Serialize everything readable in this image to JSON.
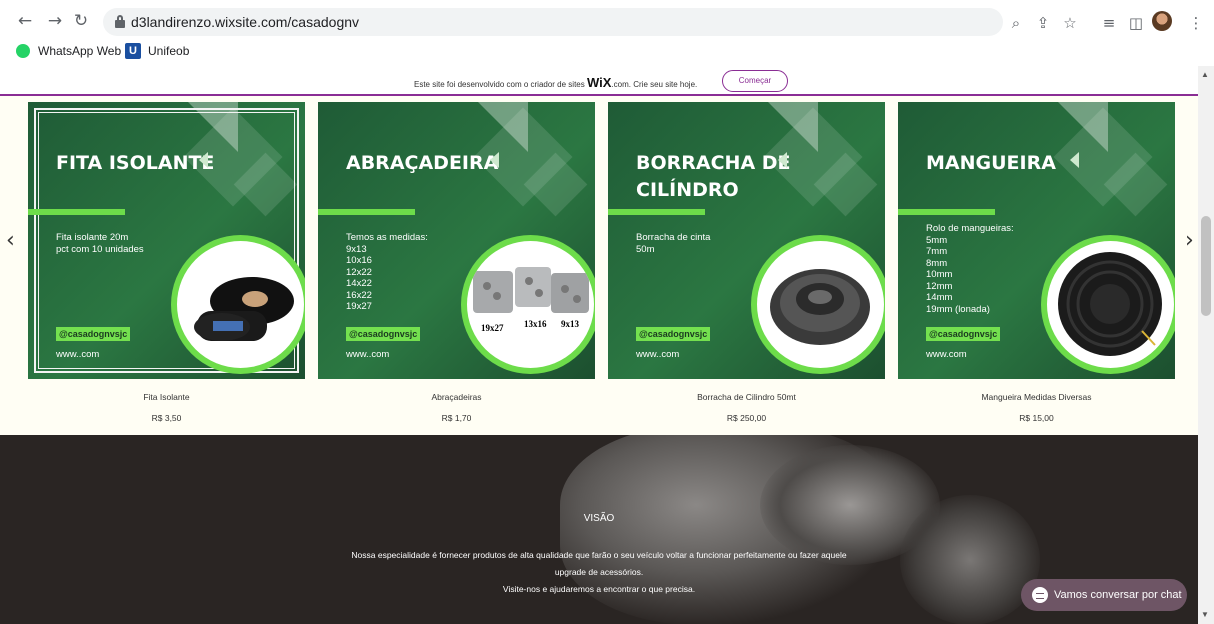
{
  "browser": {
    "url": "d3landirenzo.wixsite.com/casadognv",
    "bookmarks": [
      "WhatsApp Web",
      "Unifeob"
    ],
    "unifeob_icon_letter": "U"
  },
  "wix_banner": {
    "text_before": "Este site foi desenvolvido com o criador de sites",
    "brand": "WiX",
    "text_after": ".com. Crie seu site hoje.",
    "button": "Começar"
  },
  "products": [
    {
      "title_lines": [
        "FITA ISOLANTE"
      ],
      "desc": "Fita isolante 20m\npct com 10 unidades",
      "handle": "@casadognvsjc",
      "www": "www..com",
      "name": "Fita Isolante",
      "price": "R$ 3,50"
    },
    {
      "title_lines": [
        "ABRAÇADEIRA"
      ],
      "desc": "Temos as medidas:\n9x13\n10x16\n12x22\n14x22\n16x22\n19x27",
      "handle": "@casadognvsjc",
      "www": "www..com",
      "image_labels": [
        "19x27",
        "13x16",
        "9x13"
      ],
      "name": "Abraçadeiras",
      "price": "R$ 1,70"
    },
    {
      "title_lines": [
        "BORRACHA DE",
        "CILÍNDRO"
      ],
      "desc": "Borracha de cinta\n50m",
      "handle": "@casadognvsjc",
      "www": "www..com",
      "name": "Borracha de Cilindro 50mt",
      "price": "R$ 250,00"
    },
    {
      "title_lines": [
        "MANGUEIRA"
      ],
      "desc": "Rolo de mangueiras:\n5mm\n7mm\n8mm\n10mm\n12mm\n14mm\n19mm (lonada)",
      "handle": "@casadognvsjc",
      "www": "www.com",
      "name": "Mangueira Medidas Diversas",
      "price": "R$ 15,00"
    }
  ],
  "vision": {
    "title": "VISÃO",
    "lines": [
      "Nossa especialidade é fornecer produtos de alta qualidade que farão o seu veículo voltar a funcionar perfeitamente ou fazer aquele",
      "upgrade de acessórios.",
      "Visite-nos e ajudaremos a encontrar o que precisa."
    ]
  },
  "chat": {
    "label": "Vamos conversar por chat"
  },
  "icons": {
    "back": "arrow-left-icon",
    "forward": "arrow-right-icon",
    "reload": "reload-icon",
    "zoom": "zoom-icon",
    "share": "share-icon",
    "star": "star-icon",
    "media": "media-control-icon",
    "sidepanel": "side-panel-icon",
    "menu": "kebab-menu-icon"
  },
  "colors": {
    "card_green": "#2b7742",
    "accent_green": "#6ddc4a",
    "wix_purple": "#8a2d94",
    "dark_section": "#2a2523",
    "chat_bg": "#6e5565"
  }
}
